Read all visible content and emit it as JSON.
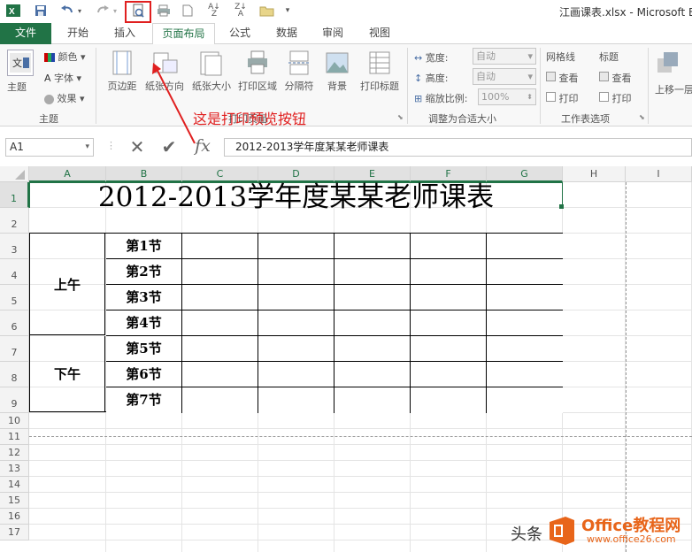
{
  "window": {
    "title": "江画课表.xlsx - Microsoft E"
  },
  "tabs": [
    "文件",
    "开始",
    "插入",
    "页面布局",
    "公式",
    "数据",
    "审阅",
    "视图"
  ],
  "ribbon": {
    "themes": {
      "main": "主题",
      "colors": "颜色",
      "fonts": "字体",
      "effects": "效果",
      "group": "主题"
    },
    "page_setup": [
      "页边距",
      "纸张方向",
      "纸张大小",
      "打印区域",
      "分隔符",
      "背景",
      "打印标题"
    ],
    "page_setup_group": "打印页面",
    "scale": {
      "width_label": "宽度:",
      "width_value": "自动",
      "height_label": "高度:",
      "height_value": "自动",
      "zoom_label": "缩放比例:",
      "zoom_value": "100%",
      "group": "调整为合适大小"
    },
    "sheet_options": {
      "gridlines": "网格线",
      "headings": "标题",
      "view": "查看",
      "print": "打印",
      "group": "工作表选项"
    },
    "arrange": {
      "bring_forward": "上移一层"
    }
  },
  "annotation": "这是打印预览按钮",
  "formula_bar": {
    "name_box": "A1",
    "formula": "2012-2013学年度某某老师课表"
  },
  "grid": {
    "columns": [
      "A",
      "B",
      "C",
      "D",
      "E",
      "F",
      "G",
      "H",
      "I"
    ],
    "rows": [
      "1",
      "2",
      "3",
      "4",
      "5",
      "6",
      "7",
      "8",
      "9",
      "10",
      "11",
      "12",
      "13",
      "14",
      "15",
      "16",
      "17"
    ],
    "title": "2012-2013学年度某某老师课表",
    "morning": "上午",
    "afternoon": "下午",
    "periods": [
      "第1节",
      "第2节",
      "第3节",
      "第4节",
      "第5节",
      "第6节",
      "第7节"
    ]
  },
  "watermark": {
    "left_text": "头条",
    "brand": "Office教程网",
    "url": "www.office26.com"
  },
  "colors": {
    "excel_green": "#217346",
    "annotation_red": "#e02020",
    "watermark_orange": "#e8651a"
  }
}
